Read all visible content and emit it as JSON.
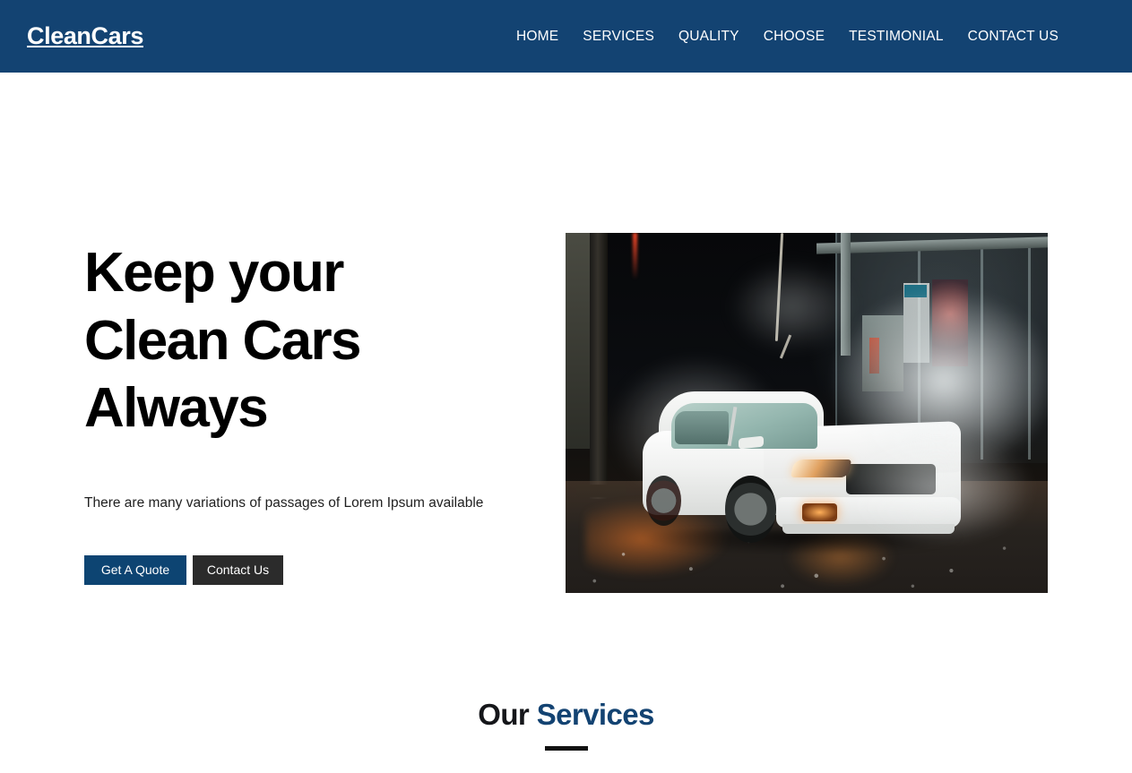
{
  "header": {
    "brand": "CleanCars",
    "nav": [
      {
        "label": "HOME"
      },
      {
        "label": "SERVICES"
      },
      {
        "label": "QUALITY"
      },
      {
        "label": "CHOOSE"
      },
      {
        "label": "TESTIMONIAL"
      },
      {
        "label": "CONTACT US"
      }
    ],
    "background_color": "#134372",
    "text_color": "#ffffff"
  },
  "hero": {
    "title_line1": "Keep your",
    "title_line2": "Clean Cars",
    "title_line3": "Always",
    "subtitle": "There are many variations of passages of Lorem Ipsum available",
    "primary_button": "Get A Quote",
    "secondary_button": "Contact Us",
    "primary_button_color": "#0d4472",
    "secondary_button_color": "#2b2b2b",
    "title_color": "#000000",
    "image_alt": "White sports car being washed at night with steam and spray in a car wash bay"
  },
  "services": {
    "heading_plain": "Our ",
    "heading_accent": "Services",
    "accent_color": "#134372",
    "underline_color": "#111111"
  }
}
